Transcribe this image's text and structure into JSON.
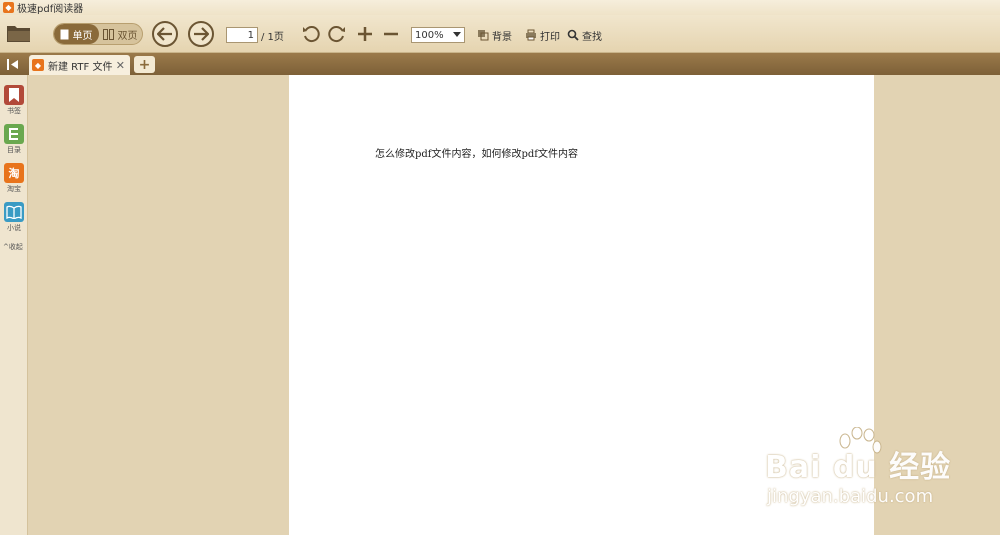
{
  "app": {
    "title": "极速pdf阅读器"
  },
  "toolbar": {
    "single_page_label": "单页",
    "double_page_label": "双页",
    "page_current": "1",
    "page_total": "/ 1页",
    "zoom_value": "100%",
    "background_label": "背景",
    "print_label": "打印",
    "find_label": "查找"
  },
  "tabs": [
    {
      "label": "新建 RTF 文件"
    }
  ],
  "sidebar": {
    "items": [
      {
        "label": "书签",
        "icon": "bookmark-icon",
        "color": "#b24a3a"
      },
      {
        "label": "目录",
        "icon": "toc-icon",
        "color": "#6aa84f"
      },
      {
        "label": "淘宝",
        "icon": "taobao-icon",
        "color": "#e8741c"
      },
      {
        "label": "小说",
        "icon": "book-icon",
        "color": "#3a9bc4"
      }
    ],
    "collapse_label": "收起"
  },
  "document": {
    "text": "怎么修改pdf文件内容，如何修改pdf文件内容"
  },
  "watermark": {
    "main": "Bai du 经验",
    "sub": "jingyan.baidu.com"
  }
}
